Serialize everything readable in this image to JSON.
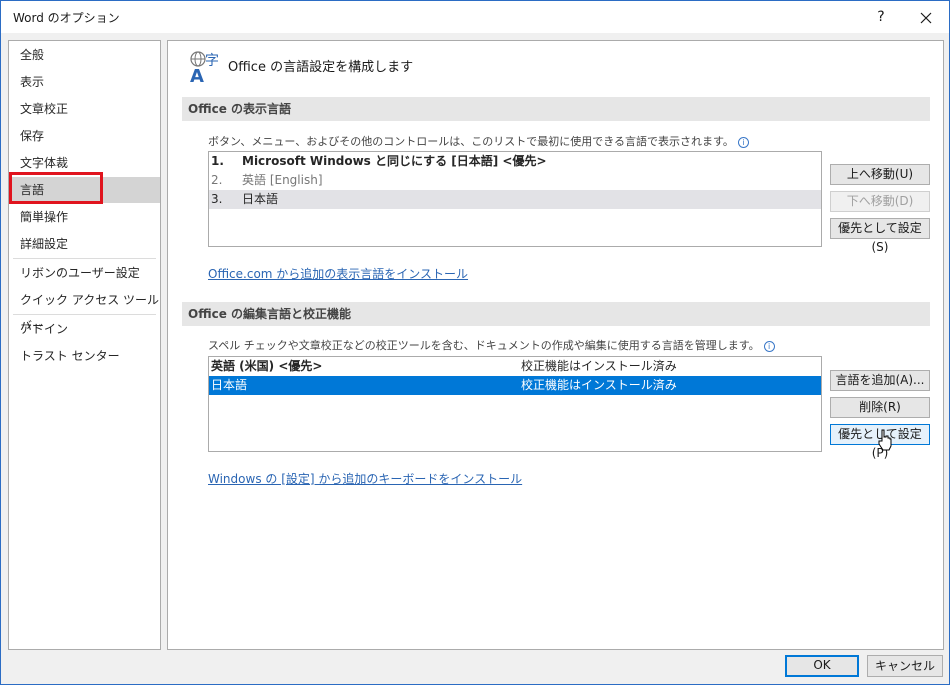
{
  "window": {
    "title": "Word のオプション",
    "help": "?",
    "colors": {
      "accent": "#0078d7",
      "highlight": "#e0141e"
    }
  },
  "sidebar": {
    "items": [
      {
        "label": "全般"
      },
      {
        "label": "表示"
      },
      {
        "label": "文章校正"
      },
      {
        "label": "保存"
      },
      {
        "label": "文字体裁"
      },
      {
        "label": "言語",
        "selected": true
      },
      {
        "label": "簡単操作"
      },
      {
        "label": "詳細設定"
      },
      {
        "label": "リボンのユーザー設定"
      },
      {
        "label": "クイック アクセス ツール バー"
      },
      {
        "label": "アドイン"
      },
      {
        "label": "トラスト センター"
      }
    ]
  },
  "main": {
    "header_title": "Office の言語設定を構成します",
    "header_icon": "language-icon",
    "display": {
      "section_title": "Office の表示言語",
      "description": "ボタン、メニュー、およびその他のコントロールは、このリストで最初に使用できる言語で表示されます。",
      "info_glyph": "i",
      "rows": [
        {
          "num": "1.",
          "name": "Microsoft Windows と同じにする [日本語] <優先>"
        },
        {
          "num": "2.",
          "name": "英語 [English]"
        },
        {
          "num": "3.",
          "name": "日本語"
        }
      ],
      "buttons": {
        "move_up": "上へ移動(U)",
        "move_down": "下へ移動(D)",
        "set_preferred": "優先として設定(S)"
      },
      "link": "Office.com から追加の表示言語をインストール"
    },
    "editing": {
      "section_title": "Office の編集言語と校正機能",
      "description": "スペル チェックや文章校正などの校正ツールを含む、ドキュメントの作成や編集に使用する言語を管理します。",
      "info_glyph": "i",
      "rows": [
        {
          "language": "英語 (米国) <優先>",
          "status": "校正機能はインストール済み"
        },
        {
          "language": "日本語",
          "status": "校正機能はインストール済み"
        }
      ],
      "buttons": {
        "add_language": "言語を追加(A)...",
        "remove": "削除(R)",
        "set_preferred": "優先として設定(P)"
      },
      "link": "Windows の [設定] から追加のキーボードをインストール"
    }
  },
  "footer": {
    "ok": "OK",
    "cancel": "キャンセル"
  }
}
